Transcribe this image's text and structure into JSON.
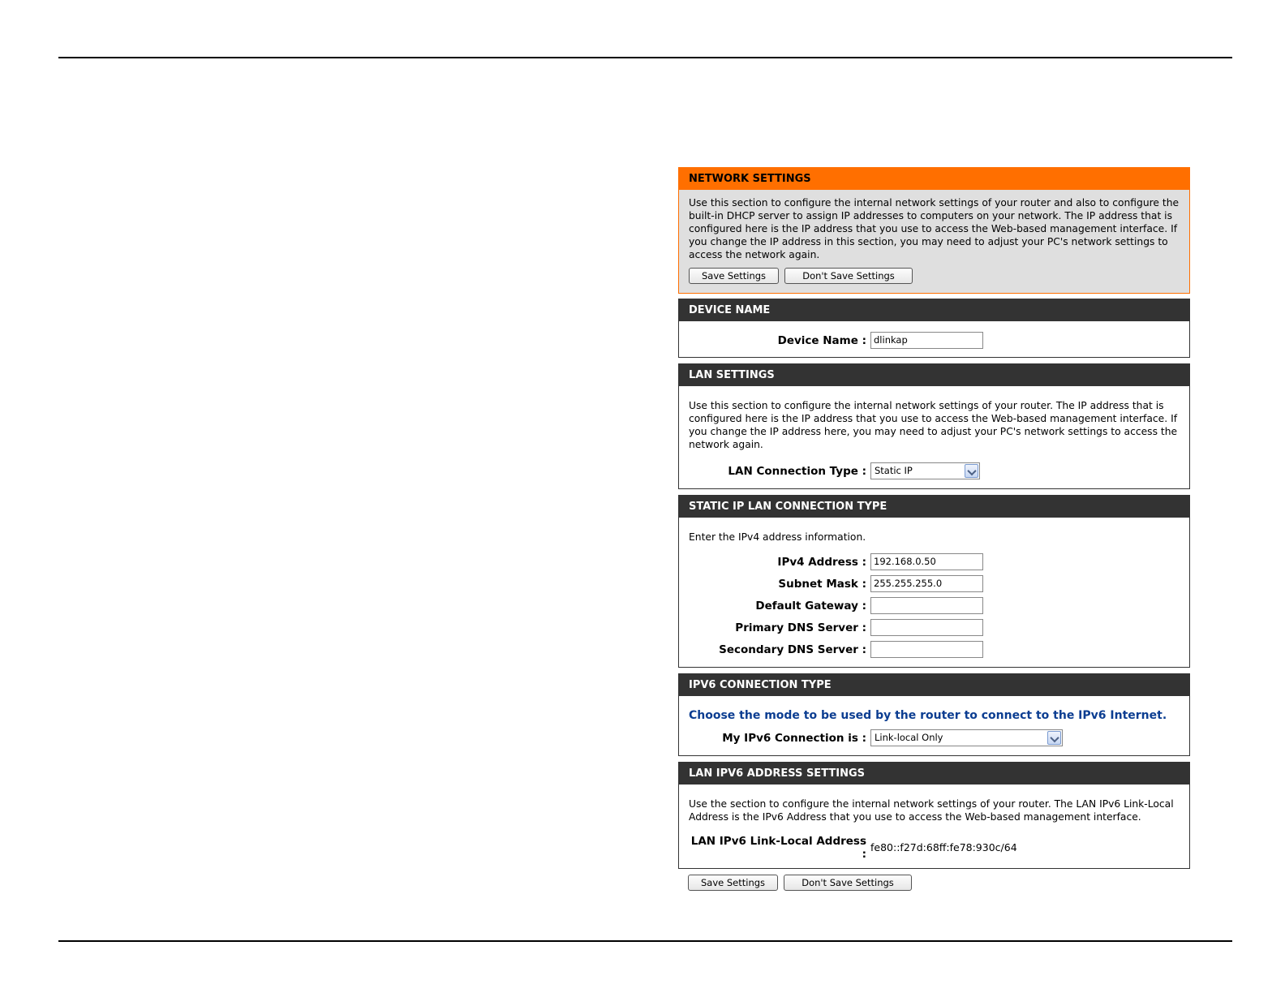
{
  "network_settings": {
    "title": "NETWORK SETTINGS",
    "description": "Use this section to configure the internal network settings of your router and also to configure the built-in DHCP server to assign IP addresses to computers on your network. The IP address that is configured here is the IP address that you use to access the Web-based management interface. If you change the IP address in this section, you may need to adjust your PC's network settings to access the network again.",
    "save_label": "Save Settings",
    "dont_save_label": "Don't Save Settings"
  },
  "device_name": {
    "title": "DEVICE NAME",
    "label": "Device Name :",
    "value": "dlinkap"
  },
  "lan_settings": {
    "title": "LAN SETTINGS",
    "description": "Use this section to configure the internal network settings of your router. The IP address that is configured here is the IP address that you use to access the Web-based management interface. If you change the IP address here, you may need to adjust your PC's network settings to access the network again.",
    "connection_type_label": "LAN Connection Type :",
    "connection_type_value": "Static IP"
  },
  "static_ip": {
    "title": "STATIC IP LAN CONNECTION TYPE",
    "intro": "Enter the IPv4 address information.",
    "fields": [
      {
        "label": "IPv4 Address :",
        "value": "192.168.0.50"
      },
      {
        "label": "Subnet Mask :",
        "value": "255.255.255.0"
      },
      {
        "label": "Default Gateway :",
        "value": ""
      },
      {
        "label": "Primary DNS Server :",
        "value": ""
      },
      {
        "label": "Secondary DNS Server :",
        "value": ""
      }
    ]
  },
  "ipv6_connection": {
    "title": "IPV6 CONNECTION TYPE",
    "prompt": "Choose the mode to be used by the router to connect to the IPv6 Internet.",
    "label": "My IPv6 Connection is :",
    "value": "Link-local Only"
  },
  "lan_ipv6": {
    "title": "LAN IPV6 ADDRESS SETTINGS",
    "description": "Use the section to configure the internal network settings of your router. The LAN IPv6 Link-Local Address is the IPv6 Address that you use to access the Web-based management interface.",
    "label": "LAN IPv6 Link-Local Address :",
    "value": "fe80::f27d:68ff:fe78:930c/64"
  },
  "footer_buttons": {
    "save_label": "Save Settings",
    "dont_save_label": "Don't Save Settings"
  }
}
